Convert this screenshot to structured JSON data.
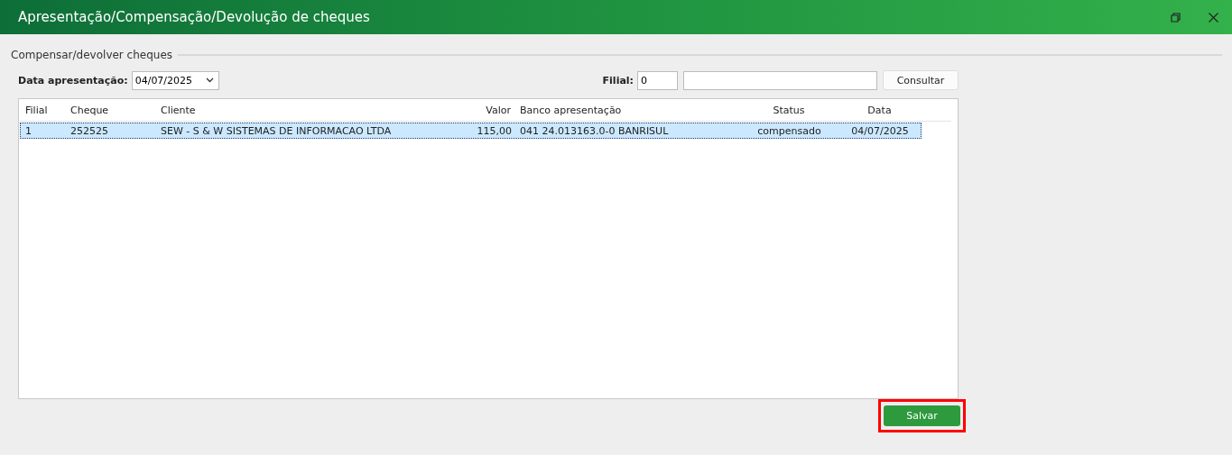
{
  "window": {
    "title": "Apresentação/Compensação/Devolução de cheques"
  },
  "group": {
    "title": "Compensar/devolver cheques"
  },
  "filters": {
    "date_label": "Data apresentação:",
    "date_value": "04/07/2025",
    "branch_label": "Filial:",
    "branch_value": "0",
    "query_button": "Consultar"
  },
  "table": {
    "columns": [
      "Filial",
      "Cheque",
      "Cliente",
      "Valor",
      "Banco apresentação",
      "Status",
      "Data"
    ],
    "rows": [
      {
        "selected": true,
        "cells": [
          "1",
          "252525",
          "SEW - S & W SISTEMAS DE INFORMACAO LTDA",
          "115,00",
          "041 24.013163.0-0 BANRISUL",
          "compensado",
          "04/07/2025"
        ]
      }
    ]
  },
  "save_button": {
    "label": "Salvar",
    "highlighted": true
  }
}
